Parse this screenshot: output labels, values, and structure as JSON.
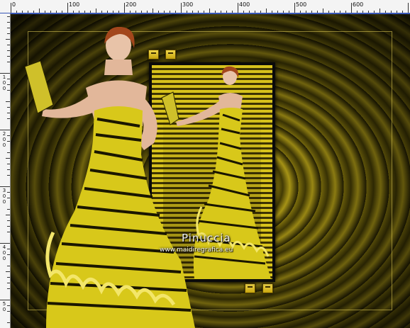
{
  "ruler": {
    "top_labels": [
      "0",
      "100",
      "200",
      "300",
      "400",
      "500",
      "600"
    ],
    "left_labels": [
      [
        "1",
        "0",
        "0"
      ],
      [
        "2",
        "0",
        "0"
      ],
      [
        "3",
        "0",
        "0"
      ],
      [
        "4",
        "0",
        "0"
      ],
      [
        "5",
        "0"
      ]
    ]
  },
  "colors": {
    "accent": "#3a58b8",
    "gold": "#d7c21c",
    "dark_gold": "#3d3303"
  },
  "watermark": {
    "name": "Pinuccia",
    "url": "www.maidiregrafica.eu"
  }
}
